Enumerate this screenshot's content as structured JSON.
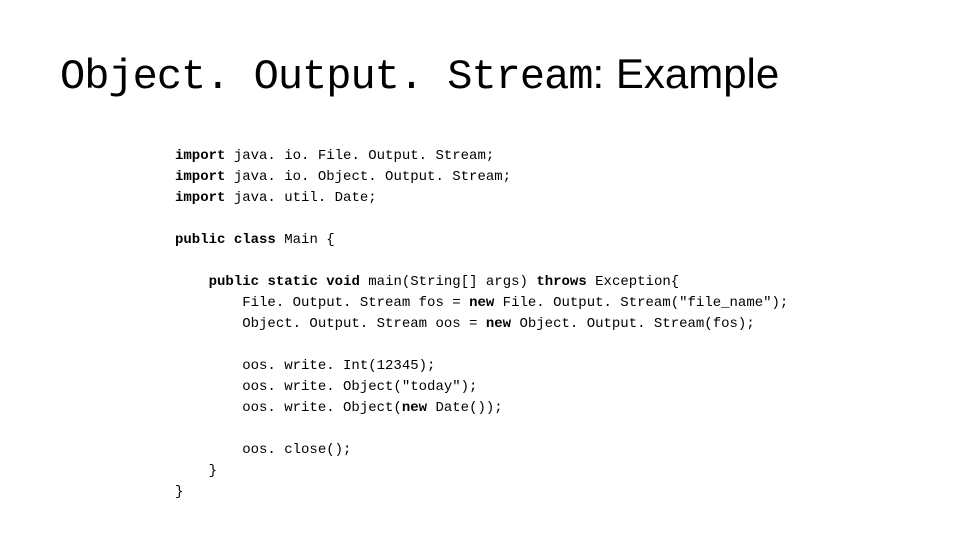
{
  "title_mono": "Object. Output. Stream",
  "title_rest": ": Example",
  "code": {
    "l1_kw": "import",
    "l1_txt": " java. io. File. Output. Stream;",
    "l2_kw": "import",
    "l2_txt": " java. io. Object. Output. Stream;",
    "l3_kw": "import",
    "l3_txt": " java. util. Date;",
    "l5_kw1": "public",
    "l5_kw2": "class",
    "l5_txt": " Main {",
    "l7_indent": "    ",
    "l7_kw1": "public",
    "l7_kw2": "static",
    "l7_kw3": "void",
    "l7_mid": " main(String[] args) ",
    "l7_kw4": "throws",
    "l7_txt": " Exception{",
    "l8_indent": "        File. Output. Stream fos = ",
    "l8_kw": "new",
    "l8_txt": " File. Output. Stream(\"file_name\");",
    "l9_indent": "        Object. Output. Stream oos = ",
    "l9_kw": "new",
    "l9_txt": " Object. Output. Stream(fos);",
    "l11": "        oos. write. Int(12345);",
    "l12": "        oos. write. Object(\"today\");",
    "l13_a": "        oos. write. Object(",
    "l13_kw": "new",
    "l13_b": " Date());",
    "l15": "        oos. close();",
    "l16": "    }",
    "l17": "}"
  }
}
